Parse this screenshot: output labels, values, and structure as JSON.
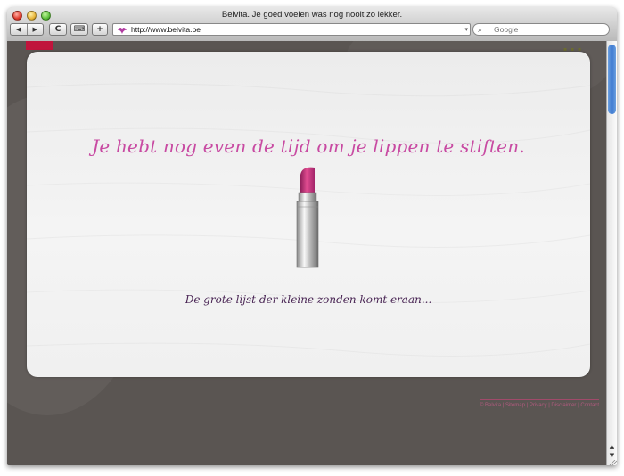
{
  "window": {
    "title": "Belvita. Je goed voelen was nog nooit zo lekker."
  },
  "toolbar": {
    "back_label": "◀",
    "forward_label": "▶",
    "reload_label": "C",
    "add_label": "+",
    "keyboard_label": "⌨"
  },
  "address_bar": {
    "url": "http://www.belvita.be"
  },
  "search": {
    "placeholder": "Google"
  },
  "page": {
    "headline": "Je hebt nog even de tijd om je lippen te stiften.",
    "subline": "De grote lijst der kleine zonden komt eraan...",
    "footer": "© Belvita | Sitemap | Privacy | Disclaimer | Contact",
    "colors": {
      "headline": "#c84aa2",
      "subline": "#4a2655",
      "background": "#5a5552",
      "card": "#f0f0f0"
    }
  }
}
